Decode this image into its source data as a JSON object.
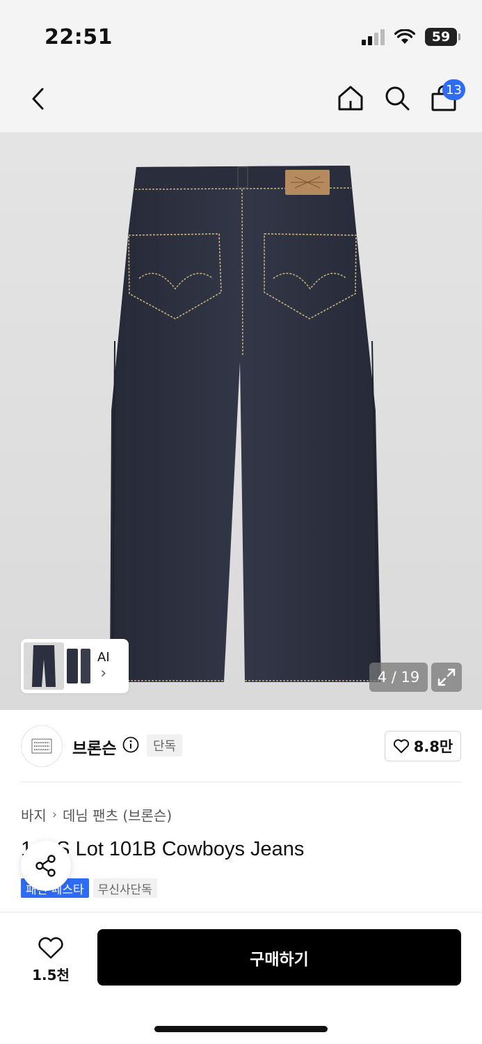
{
  "status_bar": {
    "time": "22:51",
    "battery": "59"
  },
  "nav": {
    "cart_count": "13"
  },
  "gallery": {
    "counter": "4 / 19",
    "ai_label": "AI",
    "ai_arrow": "›"
  },
  "brand": {
    "name": "브론슨",
    "exclusive_tag": "단독",
    "like_count": "8.8만"
  },
  "breadcrumb": {
    "category": "바지",
    "separator": "›",
    "subcategory": "데님 팬츠 (브론슨)"
  },
  "product": {
    "title": "1■■S Lot 101B Cowboys Jeans",
    "tags": [
      "패션 페스타",
      "무신사단독"
    ]
  },
  "bottom_bar": {
    "wish_count": "1.5천",
    "buy_label": "구매하기"
  },
  "colors": {
    "accent": "#2f6cf6",
    "buy_button": "#000000",
    "denim": "#2b3040"
  },
  "icons": {
    "back": "chevron-left-icon",
    "home": "home-icon",
    "search": "search-icon",
    "cart": "shopping-bag-icon",
    "expand": "expand-icon",
    "share": "share-icon",
    "heart": "heart-icon",
    "info": "info-icon"
  }
}
